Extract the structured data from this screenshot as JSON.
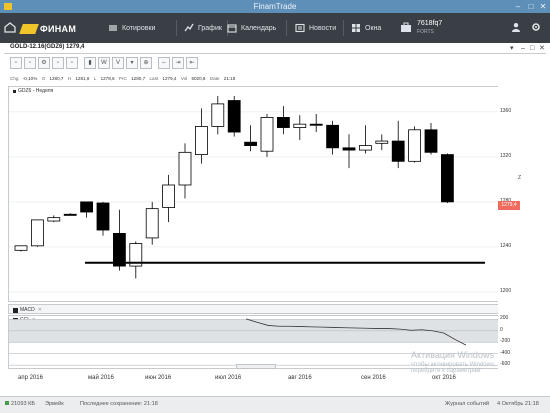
{
  "window": {
    "title": "FinamTrade"
  },
  "topbar": {
    "logo_text": "ФИНАМ",
    "nav": [
      {
        "label": "Котировки",
        "icon": "quotes-icon"
      },
      {
        "label": "График",
        "icon": "chart-icon"
      },
      {
        "label": "Календарь",
        "icon": "calendar-icon"
      },
      {
        "label": "Новости",
        "icon": "news-icon"
      },
      {
        "label": "Окна",
        "icon": "windows-icon"
      }
    ],
    "account": {
      "value": "7618fq7",
      "sub": "FORTS"
    }
  },
  "chart_window": {
    "title": "GOLD-12.16(GDZ6) 1279,4"
  },
  "infobar": {
    "chg_label": "Chg",
    "chg": "-0,10%",
    "o_label": "O",
    "o": "1280,7",
    "h_label": "H",
    "h": "1281,6",
    "l_label": "L",
    "l": "1278,6",
    "prc_label": "PrC",
    "prc": "1280,7",
    "last_label": "Last",
    "last": "1279,4",
    "vol_label": "Vol",
    "vol": "6020,8",
    "date_label": "Date",
    "date": "21:18"
  },
  "panes": {
    "main_label": "GDZ6 - Неделя",
    "macd_label": "MACD",
    "cci_label": "CCI"
  },
  "price_tag": "1279,4",
  "side_value": "Z",
  "watermark": {
    "line1": "Активация Windows",
    "line2": "Чтобы активировать Windows,",
    "line3": "перейдите к параметрам"
  },
  "status": {
    "left": "21093 КБ",
    "mode": "Эрвейк",
    "saved": "Последнее сохранение: 21:18",
    "journal": "Журнал событий",
    "datetime": "4 Октябрь 21:18"
  },
  "chart_data": [
    {
      "type": "candlestick",
      "title": "GDZ6 - Неделя",
      "y_ticks": [
        1200,
        1240,
        1280,
        1320,
        1360
      ],
      "ylim": [
        1192,
        1382
      ],
      "x_labels": [
        "апр 2016",
        "май 2016",
        "июн 2016",
        "июл 2016",
        "авг 2016",
        "сен 2016",
        "окт 2016"
      ],
      "support_line": 1226,
      "candles": [
        {
          "o": 1237,
          "c": 1241,
          "h": 1241,
          "l": 1236
        },
        {
          "o": 1241,
          "c": 1264,
          "h": 1264,
          "l": 1240
        },
        {
          "o": 1263,
          "c": 1266,
          "h": 1268,
          "l": 1262
        },
        {
          "o": 1269,
          "c": 1268,
          "h": 1270,
          "l": 1268
        },
        {
          "o": 1280,
          "c": 1271,
          "h": 1279,
          "l": 1266
        },
        {
          "o": 1279,
          "c": 1255,
          "h": 1280,
          "l": 1250
        },
        {
          "o": 1252,
          "c": 1223,
          "h": 1273,
          "l": 1219
        },
        {
          "o": 1223,
          "c": 1243,
          "h": 1245,
          "l": 1212
        },
        {
          "o": 1248,
          "c": 1274,
          "h": 1280,
          "l": 1242
        },
        {
          "o": 1275,
          "c": 1295,
          "h": 1304,
          "l": 1262
        },
        {
          "o": 1295,
          "c": 1324,
          "h": 1332,
          "l": 1283
        },
        {
          "o": 1322,
          "c": 1347,
          "h": 1363,
          "l": 1314
        },
        {
          "o": 1347,
          "c": 1367,
          "h": 1374,
          "l": 1340
        },
        {
          "o": 1370,
          "c": 1342,
          "h": 1374,
          "l": 1338
        },
        {
          "o": 1333,
          "c": 1330,
          "h": 1348,
          "l": 1325
        },
        {
          "o": 1325,
          "c": 1355,
          "h": 1358,
          "l": 1320
        },
        {
          "o": 1355,
          "c": 1346,
          "h": 1365,
          "l": 1340
        },
        {
          "o": 1346,
          "c": 1349,
          "h": 1357,
          "l": 1335
        },
        {
          "o": 1349,
          "c": 1348,
          "h": 1358,
          "l": 1342
        },
        {
          "o": 1348,
          "c": 1328,
          "h": 1352,
          "l": 1322
        },
        {
          "o": 1328,
          "c": 1326,
          "h": 1340,
          "l": 1310
        },
        {
          "o": 1326,
          "c": 1330,
          "h": 1348,
          "l": 1323
        },
        {
          "o": 1332,
          "c": 1334,
          "h": 1340,
          "l": 1326
        },
        {
          "o": 1334,
          "c": 1316,
          "h": 1352,
          "l": 1310
        },
        {
          "o": 1316,
          "c": 1344,
          "h": 1347,
          "l": 1315
        },
        {
          "o": 1344,
          "c": 1324,
          "h": 1350,
          "l": 1322
        },
        {
          "o": 1322,
          "c": 1280,
          "h": 1323,
          "l": 1279
        }
      ]
    },
    {
      "type": "line",
      "title": "CCI",
      "y_ticks": [
        200,
        0,
        -200,
        -400,
        -600
      ],
      "ylim": [
        -650,
        260
      ],
      "series": [
        {
          "values": [
            210,
            150,
            95,
            80,
            80,
            75,
            70,
            65,
            60,
            55,
            50,
            45,
            40,
            40,
            30,
            10,
            20,
            0,
            -40,
            -150,
            -250
          ]
        }
      ]
    }
  ]
}
